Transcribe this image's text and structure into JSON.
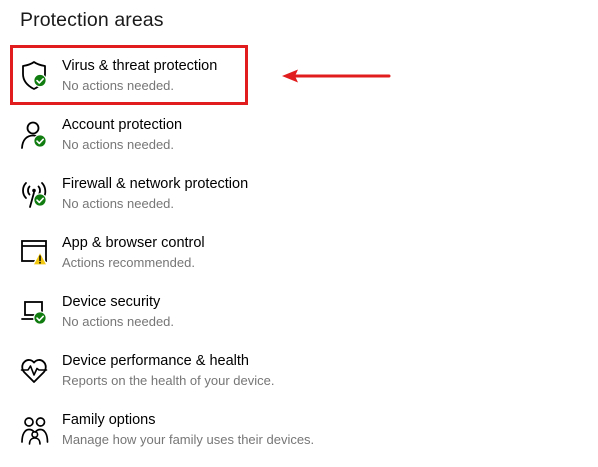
{
  "section": {
    "title": "Protection areas"
  },
  "items": [
    {
      "title": "Virus & threat protection",
      "status": "No actions needed.",
      "icon": "shield-icon",
      "badge": "ok"
    },
    {
      "title": "Account protection",
      "status": "No actions needed.",
      "icon": "person-icon",
      "badge": "ok"
    },
    {
      "title": "Firewall & network protection",
      "status": "No actions needed.",
      "icon": "antenna-icon",
      "badge": "ok"
    },
    {
      "title": "App & browser control",
      "status": "Actions recommended.",
      "icon": "browser-window-icon",
      "badge": "warning"
    },
    {
      "title": "Device security",
      "status": "No actions needed.",
      "icon": "laptop-icon",
      "badge": "ok"
    },
    {
      "title": "Device performance & health",
      "status": "Reports on the health of your device.",
      "icon": "heart-pulse-icon",
      "badge": "none"
    },
    {
      "title": "Family options",
      "status": "Manage how your family uses their devices.",
      "icon": "family-icon",
      "badge": "none"
    }
  ],
  "colors": {
    "ok_badge": "#107c10",
    "warning_badge": "#f2c811",
    "annotation_red": "#e11d1d",
    "status_text": "#767676"
  }
}
